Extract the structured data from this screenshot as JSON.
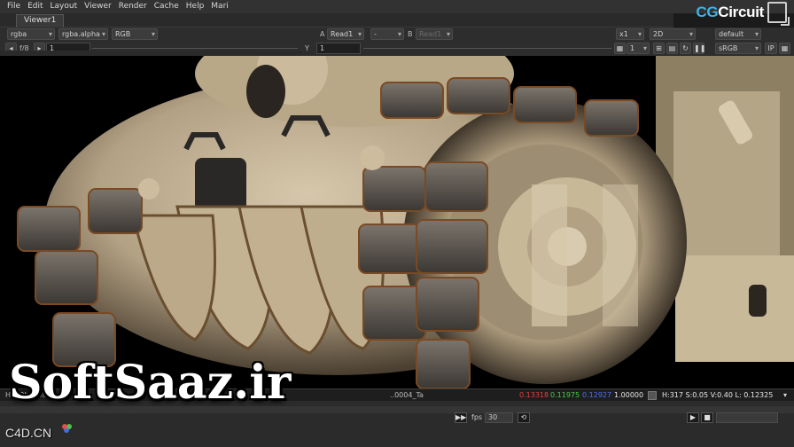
{
  "menu": [
    "File",
    "Edit",
    "Layout",
    "Viewer",
    "Render",
    "Cache",
    "Help",
    "Mari"
  ],
  "logo": {
    "text_cg": "CG",
    "text_rest": "Circuit"
  },
  "viewer_tab": "Viewer1",
  "toolbar1": {
    "channels": "rgba",
    "alpha": "rgba.alpha",
    "display": "RGB",
    "a_label": "A",
    "a_input": "Read1",
    "op": "-",
    "b_label": "B",
    "b_input": "Read1",
    "zoom": "x1",
    "view_mode": "2D",
    "lut": "default"
  },
  "toolbar2": {
    "fstop": "f/8",
    "gain": "1",
    "gamma_label": "Y",
    "gamma": "1",
    "proxy": "1",
    "colorspace": "sRGB",
    "ip_label": "IP"
  },
  "status": {
    "left": "H: 59bx1080",
    "filename": "..0004_Ta",
    "r": "0.13318",
    "g": "0.11975",
    "b": "0.12927",
    "a": "1.00000",
    "readout": "H:317 S:0.05 V:0.40  L: 0.12325"
  },
  "playback": {
    "fps_label": "fps",
    "fps": "30"
  },
  "watermark": "SoftSaaz.ir",
  "watermark2": "C4D.CN",
  "colors": {
    "r": "#e04040",
    "g": "#40d040",
    "b": "#4a6dff",
    "accent": "#3fb3e8"
  }
}
